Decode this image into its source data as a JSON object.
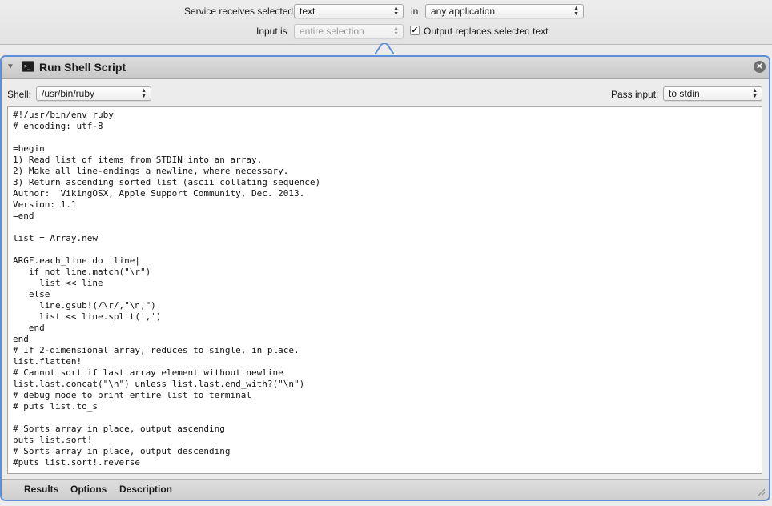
{
  "service": {
    "receives_label": "Service receives selected",
    "receives_value": "text",
    "in_label": "in",
    "in_value": "any application",
    "input_is_label": "Input is",
    "input_is_value": "entire selection",
    "output_replaces_label": "Output replaces selected text",
    "output_replaces_checked": true
  },
  "action": {
    "title": "Run Shell Script",
    "shell_label": "Shell:",
    "shell_value": "/usr/bin/ruby",
    "pass_input_label": "Pass input:",
    "pass_input_value": "to stdin",
    "script": "#!/usr/bin/env ruby\n# encoding: utf-8\n\n=begin\n1) Read list of items from STDIN into an array.\n2) Make all line-endings a newline, where necessary.\n3) Return ascending sorted list (ascii collating sequence)\nAuthor:  VikingOSX, Apple Support Community, Dec. 2013.\nVersion: 1.1\n=end\n\nlist = Array.new\n\nARGF.each_line do |line|\n   if not line.match(\"\\r\")\n     list << line\n   else\n     line.gsub!(/\\r/,\"\\n,\")\n     list << line.split(',')\n   end\nend\n# If 2-dimensional array, reduces to single, in place.\nlist.flatten!\n# Cannot sort if last array element without newline\nlist.last.concat(\"\\n\") unless list.last.end_with?(\"\\n\")\n# debug mode to print entire list to terminal\n# puts list.to_s\n\n# Sorts array in place, output ascending\nputs list.sort!\n# Sorts array in place, output descending\n#puts list.sort!.reverse",
    "tabs": [
      "Results",
      "Options",
      "Description"
    ]
  },
  "colors": {
    "action_border": "#5f8fd8",
    "background": "#ececec"
  }
}
